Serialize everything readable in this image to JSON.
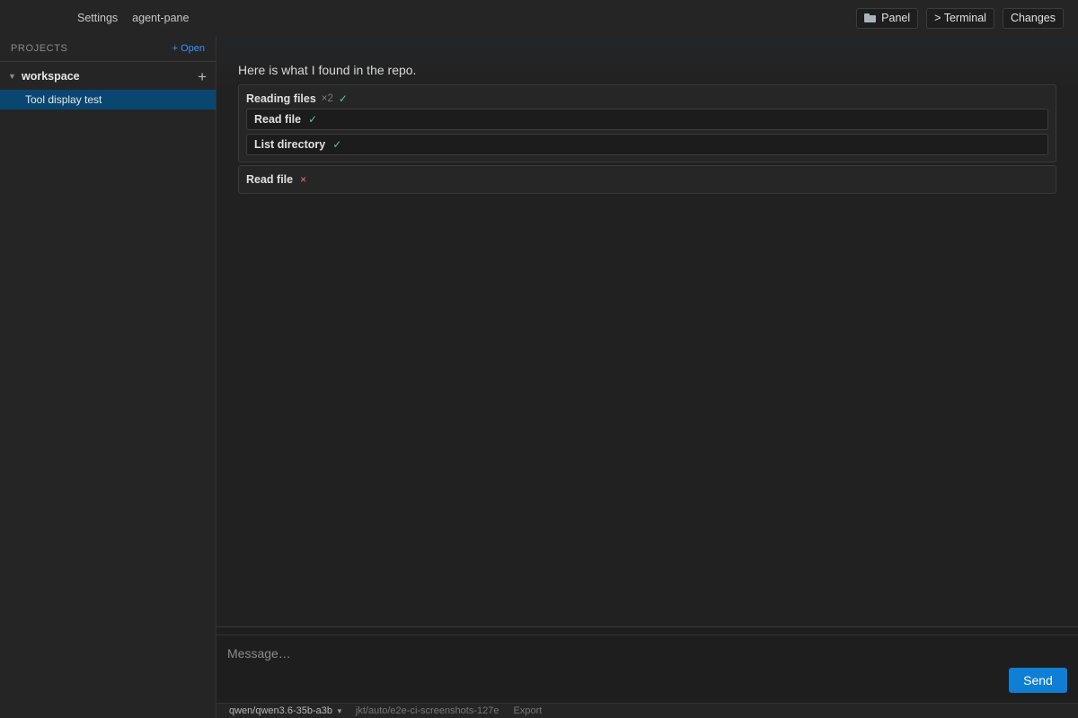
{
  "titlebar": {
    "nav": [
      "Settings",
      "agent-pane"
    ],
    "panel_label": "Panel",
    "panel_icon": "folder-icon",
    "terminal_label": "> Terminal",
    "changes_label": "Changes"
  },
  "sidebar": {
    "header_label": "PROJECTS",
    "open_label": "+ Open",
    "project": {
      "caret": "▼",
      "name": "workspace",
      "add": "+"
    },
    "sessions": [
      {
        "label": "Tool display test",
        "selected": true
      }
    ]
  },
  "chat": {
    "message": "Here is what I found in the repo.",
    "tool_group": {
      "title": "Reading files",
      "count": "×2",
      "status_glyph": "✓",
      "items": [
        {
          "label": "Read file",
          "status_glyph": "✓"
        },
        {
          "label": "List directory",
          "status_glyph": "✓"
        }
      ]
    },
    "tool_single": {
      "label": "Read file",
      "status_glyph": "×"
    }
  },
  "composer": {
    "placeholder": "Message…",
    "send_label": "Send"
  },
  "statusbar": {
    "model": "qwen/qwen3.6-35b-a3b",
    "model_arrow": "▼",
    "branch": "jkt/auto/e2e-ci-screenshots-127e",
    "export": "Export"
  },
  "colors": {
    "accent": "#0e7fd4",
    "selection": "#094771",
    "success": "#4ec9b0",
    "error": "#f0706a",
    "link": "#3794ff"
  }
}
